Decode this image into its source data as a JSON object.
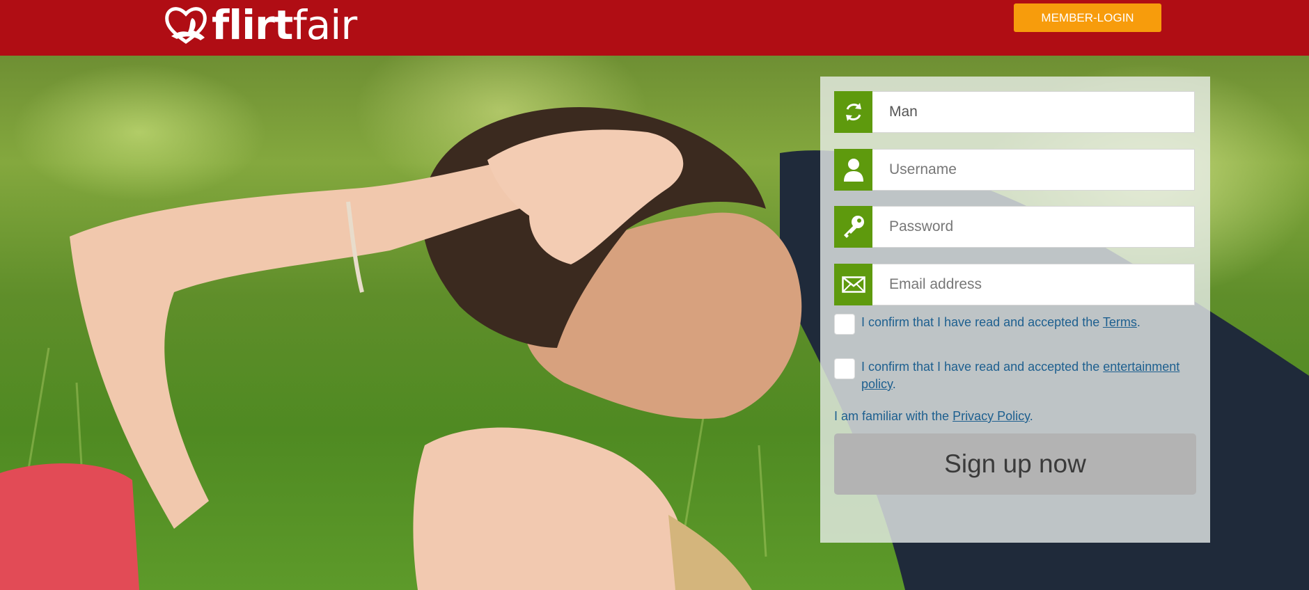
{
  "header": {
    "logo_part1": "flirt",
    "logo_part2": "fair",
    "login_label": "MEMBER-LOGIN",
    "background_color": "#b00d14",
    "login_color": "#f79c0c"
  },
  "form": {
    "gender": {
      "value": "Man",
      "icon": "refresh-icon"
    },
    "username": {
      "placeholder": "Username",
      "icon": "user-icon"
    },
    "password": {
      "placeholder": "Password",
      "icon": "key-icon"
    },
    "email": {
      "placeholder": "Email address",
      "icon": "envelope-icon"
    },
    "terms": {
      "prefix": "I confirm that I have read and accepted the ",
      "link": "Terms",
      "suffix": "."
    },
    "entertainment": {
      "prefix": "I confirm that I have read and accepted the ",
      "link": "entertainment policy",
      "suffix": "."
    },
    "privacy": {
      "prefix": "I am familiar with the ",
      "link": "Privacy Policy",
      "suffix": "."
    },
    "signup_label": "Sign up now",
    "accent_color": "#5e9a0d",
    "link_color": "#1d5f8f"
  }
}
